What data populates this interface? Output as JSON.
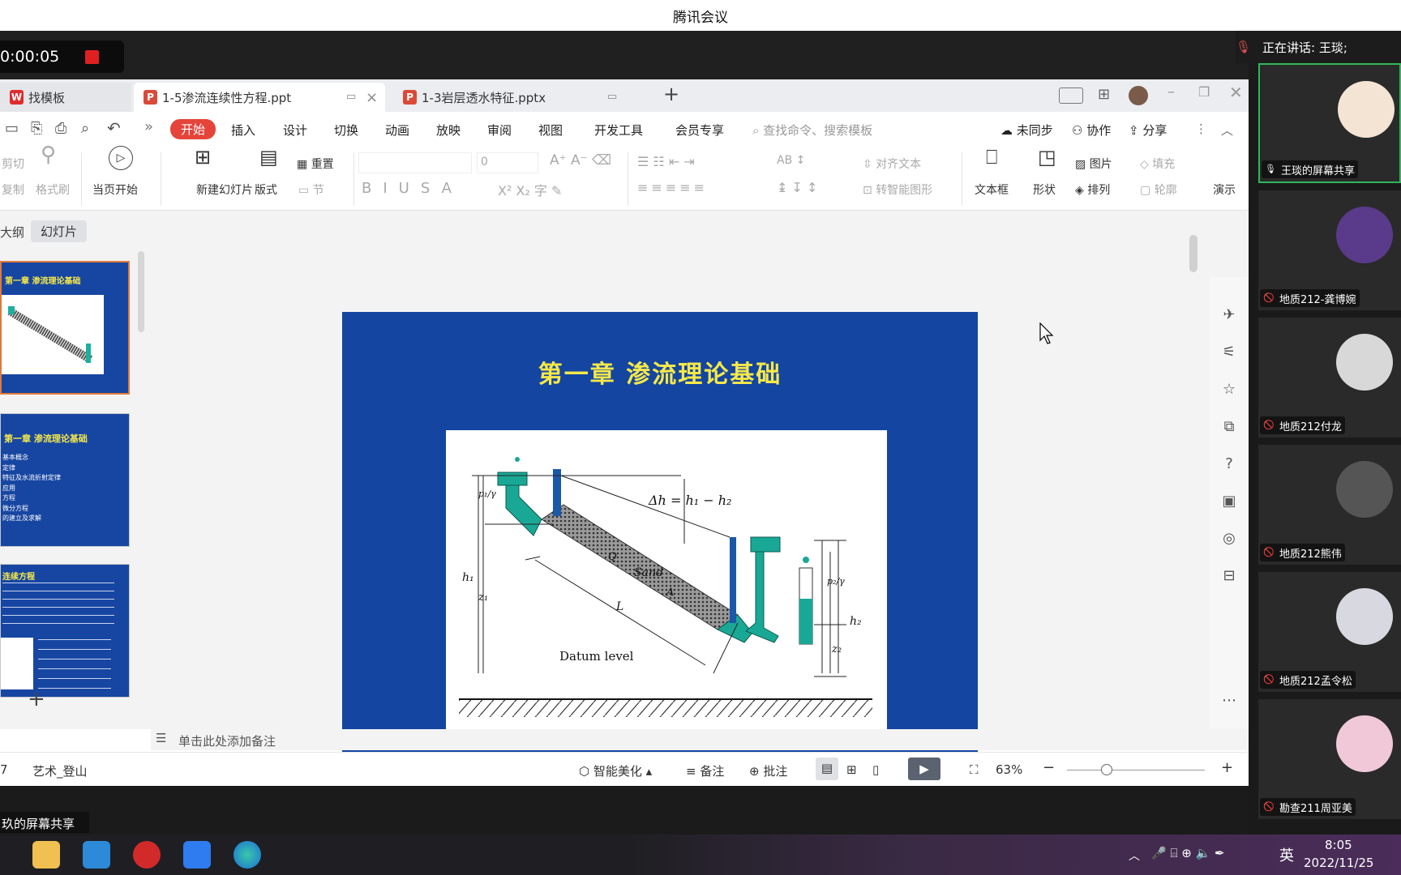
{
  "window_title": "腾讯会议",
  "recording": {
    "time": "0:00:05"
  },
  "wps": {
    "tabs": [
      {
        "label": "找模板"
      },
      {
        "label": "1-5渗流连续性方程.ppt"
      },
      {
        "label": "1-3岩层透水特征.pptx"
      }
    ],
    "new_tab": "+",
    "menu": [
      "开始",
      "插入",
      "设计",
      "切换",
      "动画",
      "放映",
      "审阅",
      "视图",
      "开发工具",
      "会员专享"
    ],
    "search_placeholder": "查找命令、搜索模板",
    "menu_right": {
      "sync": "未同步",
      "collab": "协作",
      "share": "分享"
    },
    "ribbon": {
      "cut": "剪切",
      "copy": "复制",
      "format_painter": "格式刷",
      "play_from_current": "当页开始",
      "new_slide": "新建幻灯片",
      "layout": "版式",
      "reset": "重置",
      "section": "节",
      "font_size": "0",
      "align_text": "对齐文本",
      "smart_art": "转智能图形",
      "textbox": "文本框",
      "shape": "形状",
      "picture": "图片",
      "fill": "填充",
      "arrange": "排列",
      "outline": "轮廓",
      "presenter": "演示"
    },
    "panel_tabs": {
      "outline": "大纲",
      "slides": "幻灯片"
    },
    "thumbnails": [
      {
        "title": "第一章 渗流理论基础"
      },
      {
        "title": "第一章 渗流理论基础",
        "lines": [
          "基本概念",
          "定律",
          "特征及水流折射定律",
          "应用",
          "方程",
          "微分方程",
          "的建立及求解"
        ]
      },
      {
        "title": "连续方程"
      }
    ],
    "add_slide": "+",
    "slide": {
      "title": "第一章  渗流理论基础",
      "figure_labels": {
        "delta_h": "Δh = h₁ − h₂",
        "sand": "Sand",
        "Q": "Q",
        "A": "A",
        "L": "L",
        "h1": "h₁",
        "z1": "z₁",
        "h2": "h₂",
        "z2": "z₂",
        "p_gamma_left": "p₁/γ",
        "p_gamma_right": "p₂/γ",
        "datum": "Datum level"
      }
    },
    "notes_placeholder": "单击此处添加备注",
    "status": {
      "slide_count": "7",
      "theme": "艺术_登山",
      "beautify": "智能美化",
      "notes": "备注",
      "comment": "批注",
      "zoom": "63%"
    }
  },
  "share_label": "玖的屏幕共享",
  "speaking": "正在讲话: 王琰;",
  "participants": [
    {
      "name": "王琰的屏幕共享",
      "avatar_color": "#f4e4d4"
    },
    {
      "name": "地质212-龚博婉",
      "avatar_color": "#5a3a8a"
    },
    {
      "name": "地质212付龙",
      "avatar_color": "#d8d8d8"
    },
    {
      "name": "地质212熊伟",
      "avatar_color": "#555555"
    },
    {
      "name": "地质212孟令松",
      "avatar_color": "#d8d8e0"
    },
    {
      "name": "勘查211周亚美",
      "avatar_color": "#f0c8d8"
    }
  ],
  "taskbar": {
    "ime": "英",
    "time": "8:05",
    "date": "2022/11/25"
  },
  "colors": {
    "wps_red": "#e5443a",
    "slide_blue": "#1445a0",
    "slide_title": "#f5e84a",
    "meeting_green": "#2fb75a"
  }
}
